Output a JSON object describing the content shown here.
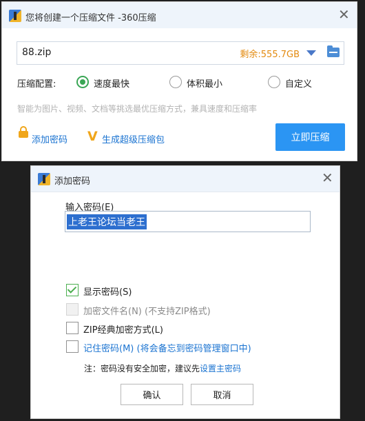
{
  "main_window": {
    "title": "您将创建一个压缩文件 -360压缩",
    "close": "✕",
    "file_name": "88.zip",
    "free_space": "剩余:555.7GB",
    "config_label": "压缩配置:",
    "options": [
      "速度最快",
      "体积最小",
      "自定义"
    ],
    "hint": "智能为图片、视频、文档等挑选最优压缩方式，兼具速度和压缩率",
    "add_password": "添加密码",
    "make_super": "生成超级压缩包",
    "compress_button": "立即压缩"
  },
  "password_dialog": {
    "title": "添加密码",
    "close": "✕",
    "field_label": "输入密码(E)",
    "password_value": "上老王论坛当老王",
    "show_password": "显示密码(S)",
    "encrypt_names": "加密文件名(N) (不支持ZIP格式)",
    "zip_classic": "ZIP经典加密方式(L)",
    "remember": "记住密码(M) (将会备忘到密码管理窗口中)",
    "note_prefix": "注：密码没有安全加密，建议先",
    "note_link": "设置主密码",
    "ok": "确认",
    "cancel": "取消"
  },
  "colors": {
    "accent": "#2b95f3",
    "link": "#1a73d1",
    "space": "#e38a0f",
    "radio_checked": "#3aa655",
    "selection": "#2d6fcf"
  }
}
